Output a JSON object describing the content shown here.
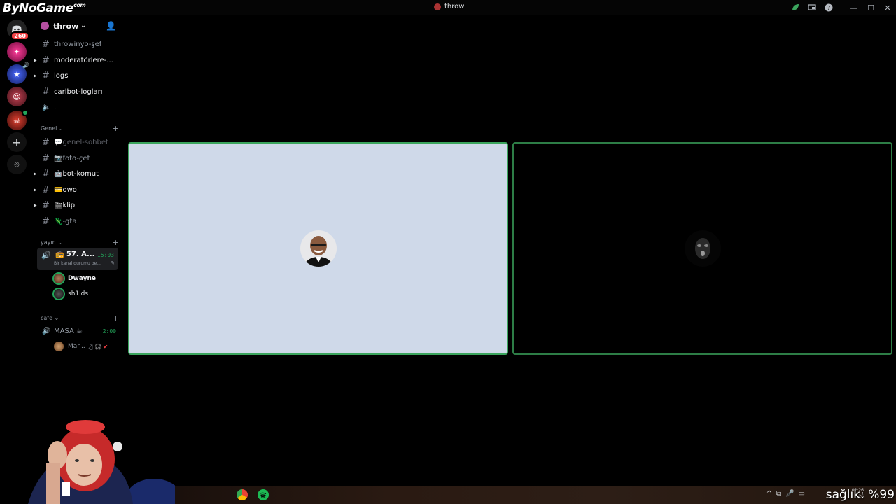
{
  "watermark": {
    "text": "ByNoGame",
    "suffix": ".com"
  },
  "window": {
    "title": "throw",
    "icons": [
      "leaf-icon",
      "screen-share-icon",
      "help-icon",
      "minimize-icon",
      "maximize-icon",
      "close-icon"
    ]
  },
  "servers": [
    {
      "name": "discord-home",
      "badge": "260",
      "color": "#5865f2"
    },
    {
      "name": "server-1",
      "color": "#c0156a"
    },
    {
      "name": "server-2",
      "color": "#2a3a8a"
    },
    {
      "name": "server-3",
      "color": "#7a1a2a"
    },
    {
      "name": "server-4",
      "color": "#8a1a1a"
    }
  ],
  "guild": {
    "name": "throw"
  },
  "channels": [
    {
      "name": "throwinyo-şef",
      "style": "normal",
      "caret": false
    },
    {
      "name": "moderatörlere-...",
      "style": "bright",
      "caret": true
    },
    {
      "name": "logs",
      "style": "bright",
      "caret": true
    },
    {
      "name": "carlbot-logları",
      "style": "bright",
      "caret": false
    },
    {
      "name": ".",
      "style": "normal",
      "caret": false
    }
  ],
  "categories": {
    "genel": "Genel",
    "yayin": "yayın",
    "cafe": "cafe"
  },
  "genel_channels": [
    {
      "name": "💬genel-sohbet",
      "style": "dim",
      "caret": false
    },
    {
      "name": "📷foto-çet",
      "style": "normal",
      "caret": false
    },
    {
      "name": "🤖bot-komut",
      "style": "bright",
      "caret": true
    },
    {
      "name": "💳owo",
      "style": "bright",
      "caret": true
    },
    {
      "name": "🎬klip",
      "style": "bright",
      "caret": true
    },
    {
      "name": "🦎-gta",
      "style": "normal",
      "caret": false
    }
  ],
  "voice_active": {
    "name": "📻 57. A...",
    "time": "15:03",
    "status": "Bir kanal durumu be..."
  },
  "voice_users": [
    {
      "name": "Dwayne",
      "speaking": true
    },
    {
      "name": "sh1lds",
      "speaking": false
    }
  ],
  "cafe_channel": {
    "name": "MASA ☕",
    "time": "2:00"
  },
  "cafe_users": [
    {
      "name": "Mar..."
    }
  ],
  "overlay_text": "sağlık: %99",
  "clock": {
    "time": "02:26",
    "date": "26"
  }
}
